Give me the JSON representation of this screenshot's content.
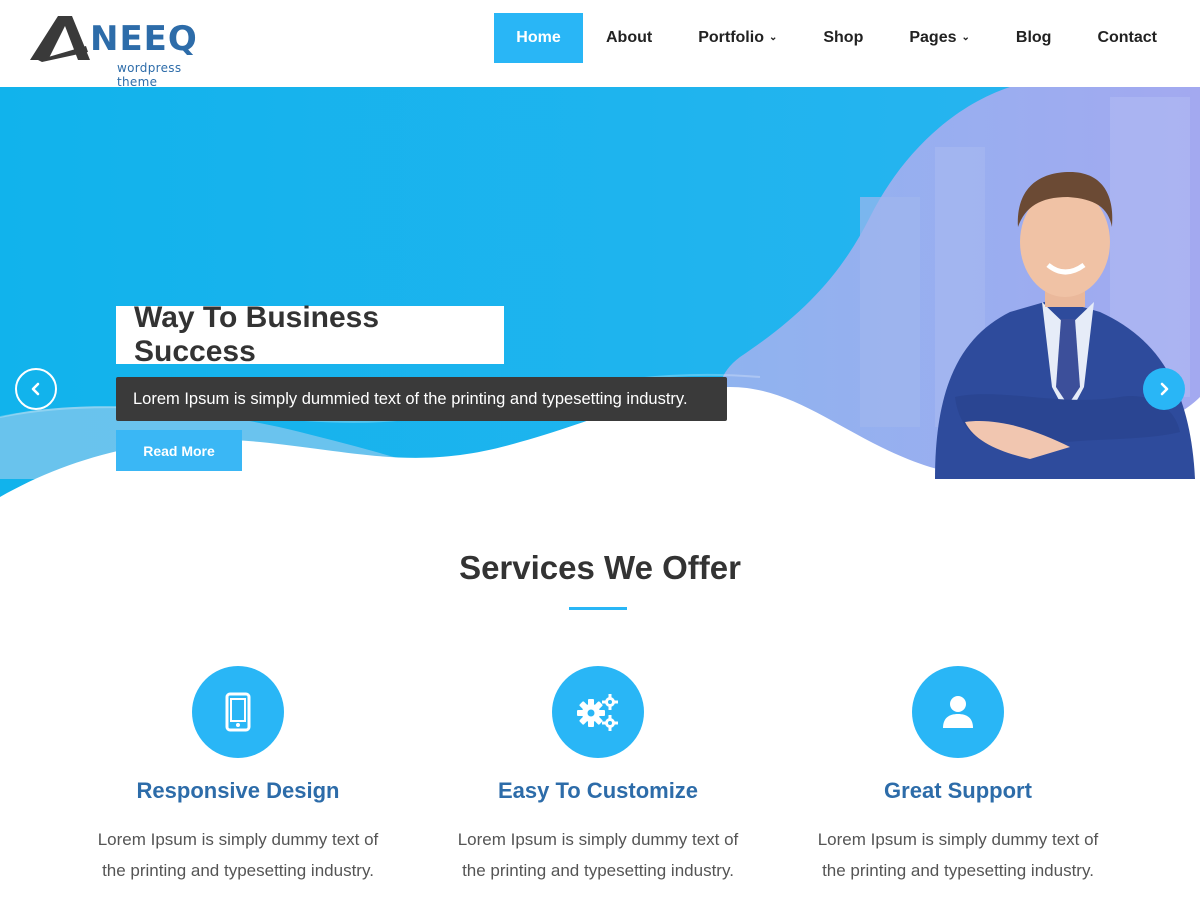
{
  "brand": {
    "logo_text": "ANEEQ",
    "tagline": "wordpress theme",
    "colors": {
      "accent": "#29b6f6",
      "heading_blue": "#2d6ca9",
      "dark": "#333333"
    }
  },
  "nav": {
    "items": [
      {
        "label": "Home",
        "active": true
      },
      {
        "label": "About"
      },
      {
        "label": "Portfolio",
        "dropdown": true
      },
      {
        "label": "Shop"
      },
      {
        "label": "Pages",
        "dropdown": true
      },
      {
        "label": "Blog"
      },
      {
        "label": "Contact"
      }
    ]
  },
  "hero": {
    "title": "Way To Business Success",
    "subtitle": "Lorem Ipsum is simply dummied text of the printing and typesetting industry.",
    "cta_label": "Read More",
    "prev_icon": "chevron-left-icon",
    "next_icon": "chevron-right-icon"
  },
  "services": {
    "heading": "Services We Offer",
    "items": [
      {
        "icon": "mobile-icon",
        "title": "Responsive Design",
        "text_line1": "Lorem Ipsum is simply dummy text of",
        "text_line2": "the printing and typesetting industry."
      },
      {
        "icon": "gears-icon",
        "title": "Easy To Customize",
        "text_line1": "Lorem Ipsum is simply dummy text of",
        "text_line2": "the printing and typesetting industry."
      },
      {
        "icon": "user-icon",
        "title": "Great Support",
        "text_line1": "Lorem Ipsum is simply dummy text of",
        "text_line2": "the printing and typesetting industry."
      }
    ]
  }
}
